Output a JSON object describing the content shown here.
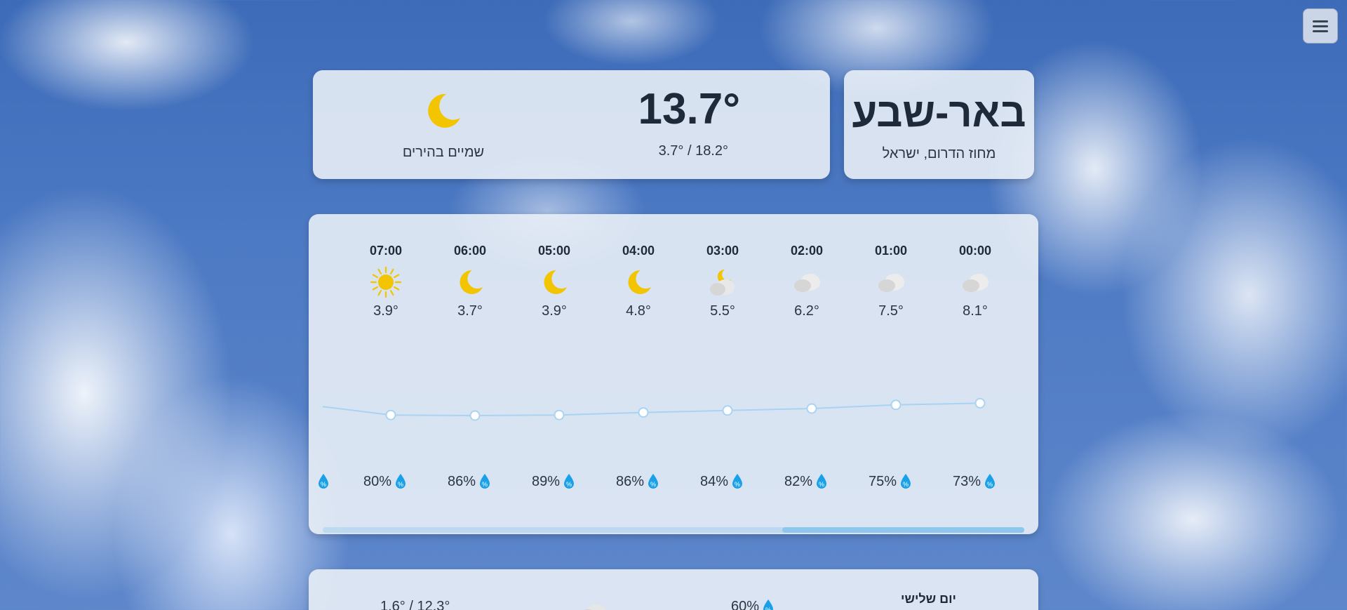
{
  "city": {
    "name": "באר-שבע",
    "region": "מחוז הדרום, ישראל"
  },
  "current": {
    "temperature": "13.7°",
    "range": "3.7° / 18.2°",
    "description": "שמיים בהירים",
    "icon": "moon-icon"
  },
  "hourly": [
    {
      "time": "00:00",
      "icon": "cloud-icon",
      "temp": "8.1°",
      "humidity": "73%"
    },
    {
      "time": "01:00",
      "icon": "cloud-icon",
      "temp": "7.5°",
      "humidity": "75%"
    },
    {
      "time": "02:00",
      "icon": "cloud-icon",
      "temp": "6.2°",
      "humidity": "82%"
    },
    {
      "time": "03:00",
      "icon": "moon-cloud-icon",
      "temp": "5.5°",
      "humidity": "84%"
    },
    {
      "time": "04:00",
      "icon": "moon-icon",
      "temp": "4.8°",
      "humidity": "86%"
    },
    {
      "time": "05:00",
      "icon": "moon-icon",
      "temp": "3.9°",
      "humidity": "89%"
    },
    {
      "time": "06:00",
      "icon": "moon-icon",
      "temp": "3.7°",
      "humidity": "86%"
    },
    {
      "time": "07:00",
      "icon": "sun-icon",
      "temp": "3.9°",
      "humidity": "80%"
    }
  ],
  "hourly_partial_humidity": "%",
  "hourly_scroll_position": 1.0,
  "daily": [
    {
      "day": "יום שלישי",
      "humidity": "60%",
      "range": "1.6° / 12.3°",
      "icon": "cloud-icon"
    }
  ],
  "colors": {
    "sun": "#f2c500",
    "moon": "#f2c500",
    "drop": "#1aa0e8",
    "line": "#a9d3f2",
    "point": "#ffffff"
  }
}
